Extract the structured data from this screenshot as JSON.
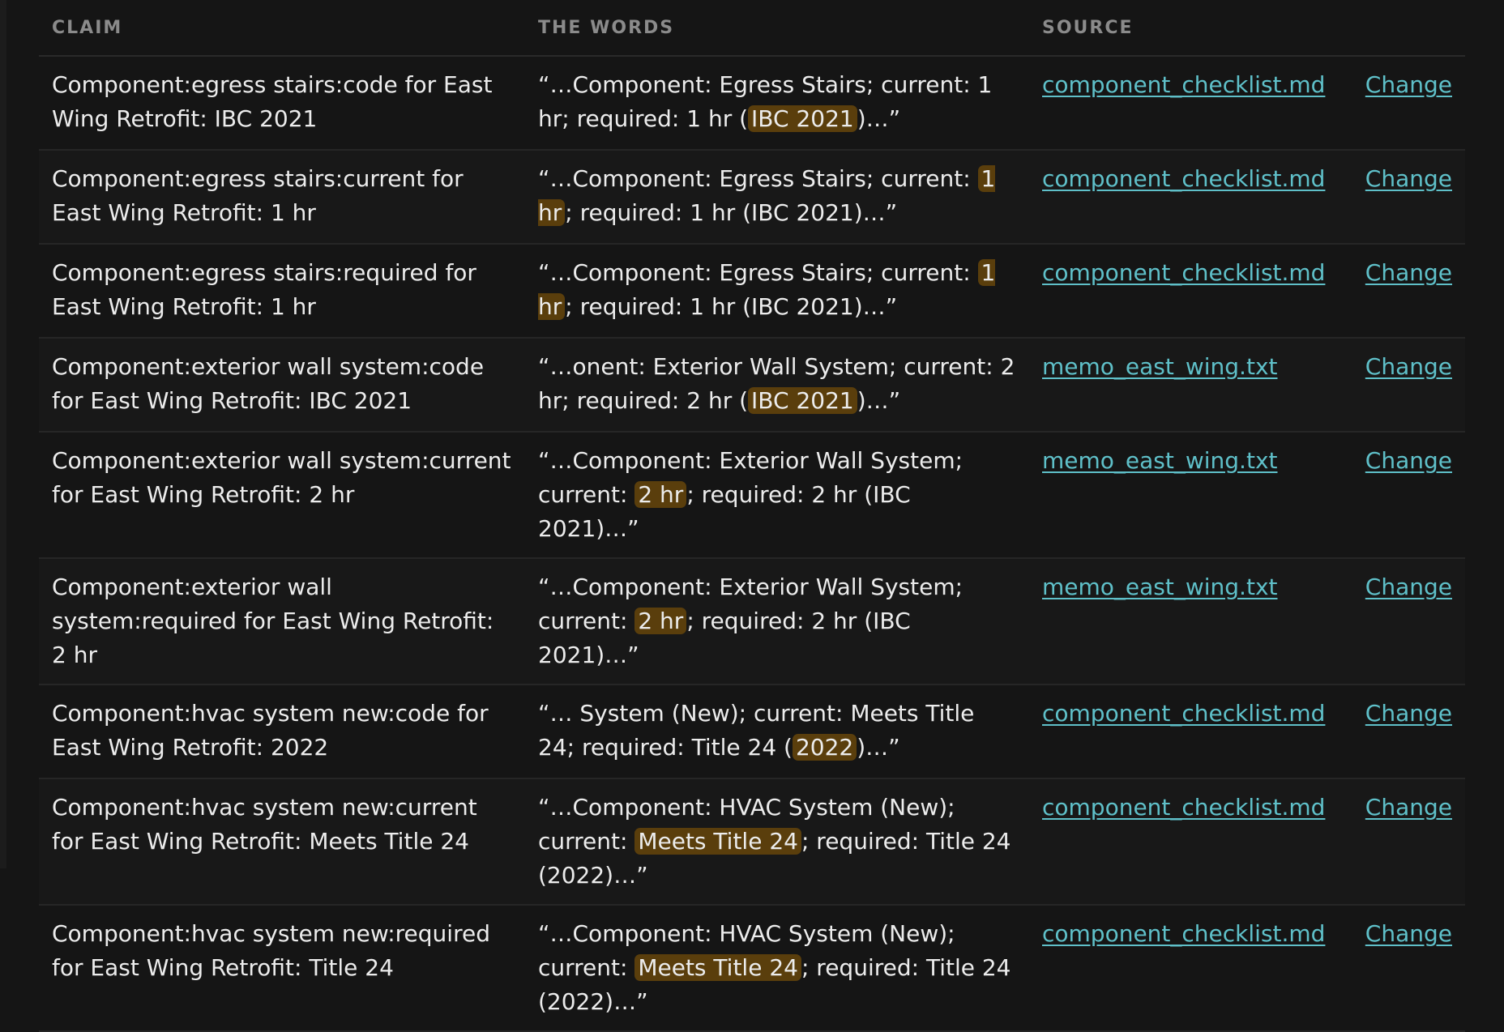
{
  "columns": {
    "claim": "CLAIM",
    "words": "THE WORDS",
    "source": "SOURCE"
  },
  "rows": [
    {
      "claim": "Component:egress stairs:code for East Wing Retrofit: IBC 2021",
      "quote_before": "“…Component: Egress Stairs; current: 1 hr; required: 1 hr (",
      "quote_highlight": "IBC 2021",
      "quote_after": ")…”",
      "source": "component_checklist.md",
      "action": "Change"
    },
    {
      "claim": "Component:egress stairs:current for East Wing Retrofit: 1 hr",
      "quote_before": "“…Component: Egress Stairs; current: ",
      "quote_highlight": "1 hr",
      "quote_after": "; required: 1 hr (IBC 2021)…”",
      "source": "component_checklist.md",
      "action": "Change"
    },
    {
      "claim": "Component:egress stairs:required for East Wing Retrofit: 1 hr",
      "quote_before": "“…Component: Egress Stairs; current: ",
      "quote_highlight": "1 hr",
      "quote_after": "; required: 1 hr (IBC 2021)…”",
      "source": "component_checklist.md",
      "action": "Change"
    },
    {
      "claim": "Component:exterior wall system:code for East Wing Retrofit: IBC 2021",
      "quote_before": "“…onent: Exterior Wall System; current: 2 hr; required: 2 hr (",
      "quote_highlight": "IBC 2021",
      "quote_after": ")…”",
      "source": "memo_east_wing.txt",
      "action": "Change"
    },
    {
      "claim": "Component:exterior wall system:current for East Wing Retrofit: 2 hr",
      "quote_before": "“…Component: Exterior Wall System; current: ",
      "quote_highlight": "2 hr",
      "quote_after": "; required: 2 hr (IBC 2021)…”",
      "source": "memo_east_wing.txt",
      "action": "Change"
    },
    {
      "claim": "Component:exterior wall system:required for East Wing Retrofit: 2 hr",
      "quote_before": "“…Component: Exterior Wall System; current: ",
      "quote_highlight": "2 hr",
      "quote_after": "; required: 2 hr (IBC 2021)…”",
      "source": "memo_east_wing.txt",
      "action": "Change"
    },
    {
      "claim": "Component:hvac system new:code for East Wing Retrofit: 2022",
      "quote_before": "“… System (New); current: Meets Title 24; required: Title 24 (",
      "quote_highlight": "2022",
      "quote_after": ")…”",
      "source": "component_checklist.md",
      "action": "Change"
    },
    {
      "claim": "Component:hvac system new:current for East Wing Retrofit: Meets Title 24",
      "quote_before": "“…Component: HVAC System (New); current: ",
      "quote_highlight": "Meets Title 24",
      "quote_after": "; required: Title 24 (2022)…”",
      "source": "component_checklist.md",
      "action": "Change"
    },
    {
      "claim": "Component:hvac system new:required for East Wing Retrofit: Title 24",
      "quote_before": "“…Component: HVAC System (New); current: ",
      "quote_highlight": "Meets Title 24",
      "quote_after": "; required: Title 24 (2022)…”",
      "source": "component_checklist.md",
      "action": "Change"
    }
  ],
  "colors": {
    "background": "#151515",
    "link": "#5fc0c9",
    "highlight": "#5a3e0c",
    "header_text": "#8b8b8b"
  }
}
